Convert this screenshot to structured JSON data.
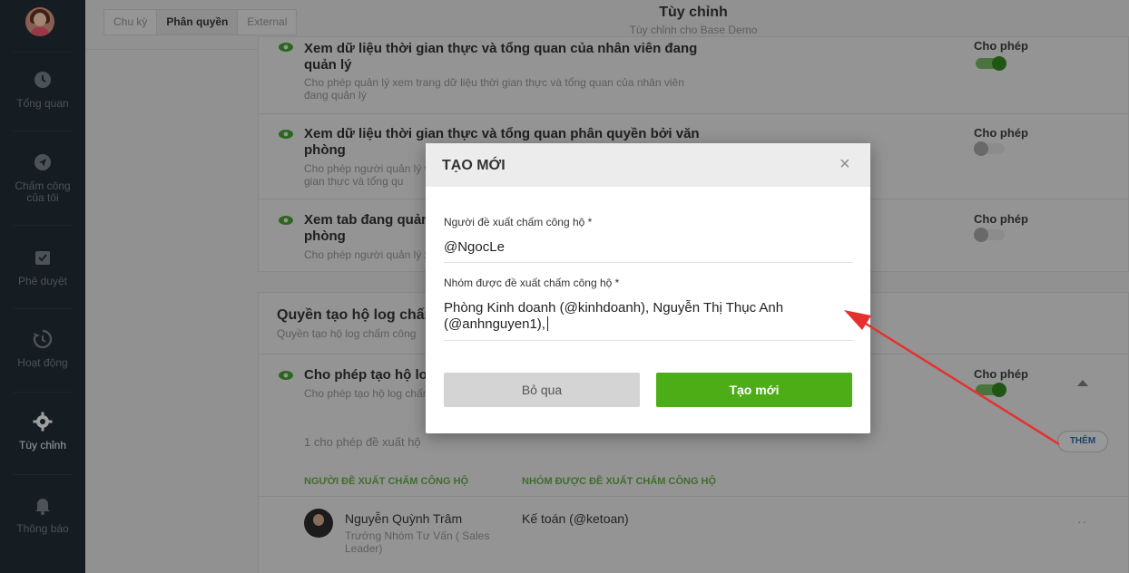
{
  "sidebar": {
    "items": [
      {
        "label": "Tổng quan",
        "icon": "clock-icon"
      },
      {
        "label": "Chấm công của tôi",
        "icon": "send-icon"
      },
      {
        "label": "Phê duyệt",
        "icon": "check-calendar-icon"
      },
      {
        "label": "Hoạt động",
        "icon": "history-icon"
      },
      {
        "label": "Tùy chỉnh",
        "icon": "gear-icon",
        "active": true
      },
      {
        "label": "Thông báo",
        "icon": "bell-icon"
      }
    ]
  },
  "header": {
    "tabs": [
      "Chu kỳ",
      "Phân quyền",
      "External"
    ],
    "active_tab": "Phân quyền",
    "title": "Tùy chỉnh",
    "subtitle": "Tùy chỉnh cho Base Demo"
  },
  "permissions": [
    {
      "title_line1": "Xem dữ liệu thời gian thực và tổng quan của nhân viên đang",
      "title_line2": "quản lý",
      "desc_line1": "Cho phép quản lý xem trang dữ liệu thời gian thực và tổng quan của nhân viên",
      "desc_line2": "đang quản lý",
      "status": "Cho phép",
      "enabled": true
    },
    {
      "title_line1": "Xem dữ liệu thời gian thực và tổng quan phân quyền bởi văn",
      "title_line2": "phòng",
      "desc_line1": "Cho phép người quản lý v",
      "desc_line2": "gian thực và tổng qu",
      "status": "Cho phép",
      "enabled": false
    },
    {
      "title_line1": "Xem tab đang quản",
      "title_line2": "phòng",
      "desc_line1": "Cho phép người quản lý x",
      "status": "Cho phép",
      "enabled": false
    }
  ],
  "section": {
    "title": "Quyền tạo hộ log chấm",
    "subtitle": "Quyền tạo hộ log chấm công",
    "perm_title": "Cho phép tạo hộ log",
    "perm_desc": "Cho phép tạo hộ log chấm",
    "status": "Cho phép",
    "enabled": true,
    "count_text": "1 cho phép đề xuất hộ",
    "add_label": "THÊM",
    "col_proposer": "NGƯỜI ĐỀ XUẤT CHẤM CÔNG HỘ",
    "col_group": "NHÓM ĐƯỢC ĐỀ XUẤT CHẤM CÔNG HỘ",
    "rows": [
      {
        "name": "Nguyễn Quỳnh Trâm",
        "role_line1": "Trưởng Nhóm Tư Vấn ( Sales",
        "role_line2": "Leader)",
        "group": "Kế toán (@ketoan)"
      }
    ]
  },
  "modal": {
    "title": "TẠO MỚI",
    "close_glyph": "×",
    "proposer_label": "Người đề xuất chấm công hộ *",
    "proposer_value": "@NgocLe",
    "group_label": "Nhóm được đề xuất chấm công hộ *",
    "group_value_line1": "Phòng Kinh doanh (@kinhdoanh), Nguyễn Thị Thục Anh",
    "group_value_line2": "(@anhnguyen1),",
    "skip_label": "Bỏ qua",
    "create_label": "Tạo mới"
  },
  "colors": {
    "accent_green": "#4cad16",
    "annotation_arrow": "#e53030"
  }
}
